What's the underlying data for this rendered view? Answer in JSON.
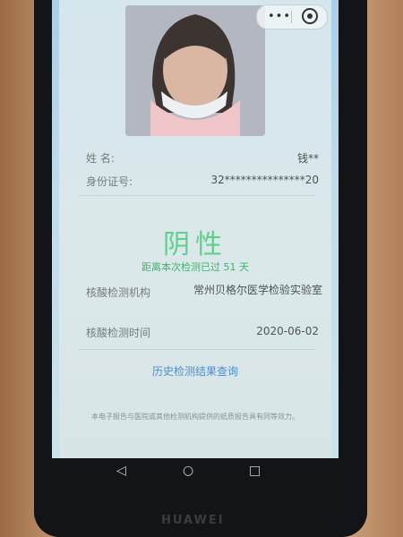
{
  "capsule": {
    "more_icon": "more-dots-icon",
    "close_icon": "close-target-icon"
  },
  "info": {
    "name_label": "姓    名:",
    "name_value": "钱**",
    "id_label": "身份证号:",
    "id_value": "32***************20"
  },
  "result": {
    "status": "阴性",
    "days_since": "距离本次检测已过 51 天"
  },
  "details": {
    "institution_label": "核酸检测机构",
    "institution_value": "常州贝格尔医学检验实验室",
    "time_label": "核酸检测时间",
    "time_value": "2020-06-02"
  },
  "history_link": "历史检测结果查询",
  "footer_note": "本电子报告与医院或其他检测机构提供的纸质报告具有同等效力。",
  "navbar": {
    "back": "◁",
    "home": "○",
    "recent": "□"
  },
  "brand": "HUAWEI",
  "colors": {
    "negative_green": "#5fd08a",
    "link_blue": "#4b8fcf"
  }
}
